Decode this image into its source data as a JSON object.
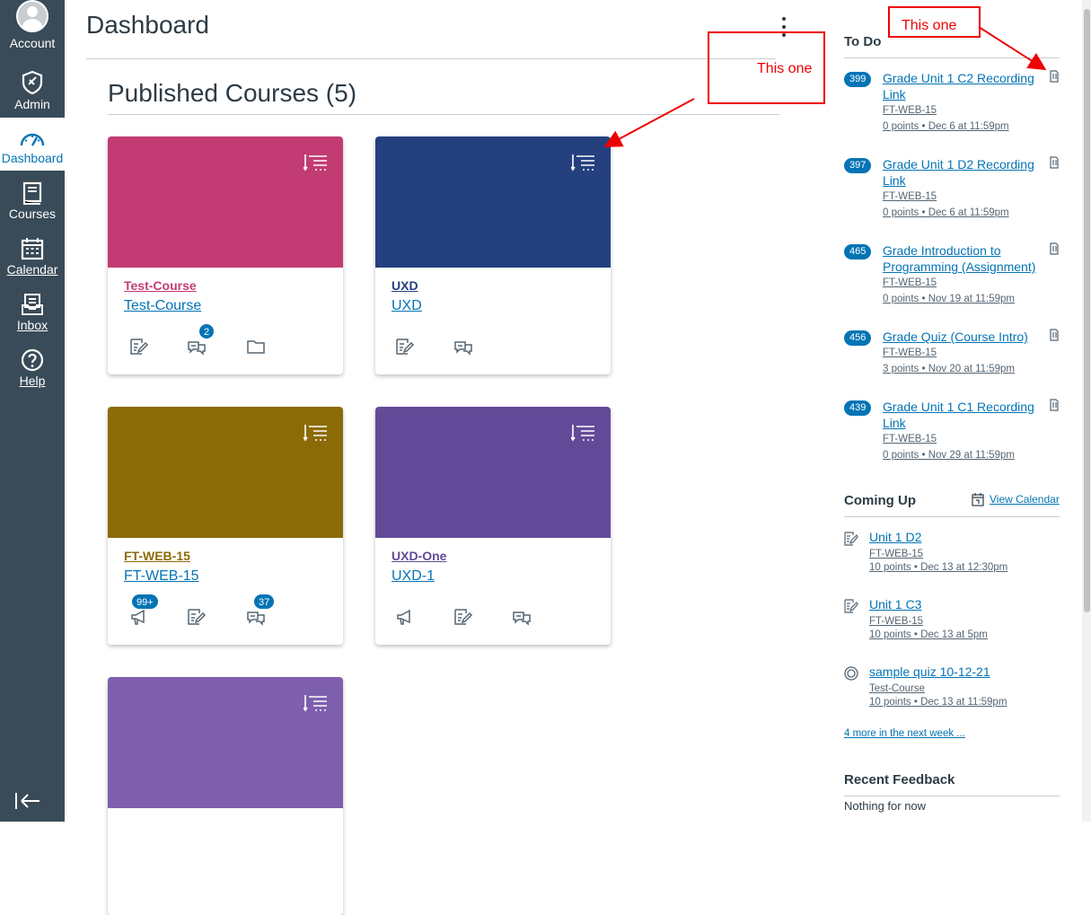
{
  "nav": {
    "account": "Account",
    "admin": "Admin",
    "dashboard": "Dashboard",
    "courses": "Courses",
    "calendar": "Calendar",
    "inbox": "Inbox",
    "help": "Help"
  },
  "header": {
    "title": "Dashboard"
  },
  "main": {
    "heading": "Published Courses (5)",
    "cards": [
      {
        "code": "Test-Course",
        "name": "Test-Course",
        "color": "#c23c73",
        "discussion_badge": "2"
      },
      {
        "code": "UXD",
        "name": "UXD",
        "color": "#24407f"
      },
      {
        "code": "FT-WEB-15",
        "name": "FT-WEB-15",
        "color": "#8b6b06",
        "announcement_badge": "99+",
        "discussion_badge": "37"
      },
      {
        "code": "UXD-One",
        "name": "UXD-1",
        "color": "#634a99"
      },
      {
        "code": "",
        "name": "",
        "color": "#7e5fae"
      }
    ]
  },
  "todo": {
    "heading": "To Do",
    "items": [
      {
        "count": "399",
        "title": "Grade Unit 1 C2 Recording Link",
        "course": "FT-WEB-15",
        "meta": "0 points • Dec 6 at 11:59pm"
      },
      {
        "count": "397",
        "title": "Grade Unit 1 D2 Recording Link",
        "course": "FT-WEB-15",
        "meta": "0 points • Dec 6 at 11:59pm"
      },
      {
        "count": "465",
        "title": "Grade Introduction to Programming (Assignment)",
        "course": "FT-WEB-15",
        "meta": "0 points • Nov 19 at 11:59pm"
      },
      {
        "count": "456",
        "title": "Grade Quiz (Course Intro)",
        "course": "FT-WEB-15",
        "meta": "3 points • Nov 20 at 11:59pm"
      },
      {
        "count": "439",
        "title": "Grade Unit 1 C1 Recording Link",
        "course": "FT-WEB-15",
        "meta": "0 points • Nov 29 at 11:59pm"
      }
    ]
  },
  "coming_up": {
    "heading": "Coming Up",
    "view_calendar": "View Calendar",
    "items": [
      {
        "title": "Unit 1 D2",
        "course": "FT-WEB-15",
        "meta": "10 points • Dec 13 at 12:30pm",
        "icon": "assignment-icon"
      },
      {
        "title": "Unit 1 C3",
        "course": "FT-WEB-15",
        "meta": "10 points • Dec 13 at 5pm",
        "icon": "assignment-icon"
      },
      {
        "title": "sample quiz 10-12-21",
        "course": "Test-Course",
        "meta": "10 points • Dec 13 at 11:59pm",
        "icon": "quiz-icon"
      }
    ],
    "more": "4 more in the next week ..."
  },
  "feedback": {
    "heading": "Recent Feedback",
    "empty": "Nothing for now"
  },
  "annotations": {
    "label_1": "This one",
    "label_2": "This one",
    "color": "#e00000"
  }
}
